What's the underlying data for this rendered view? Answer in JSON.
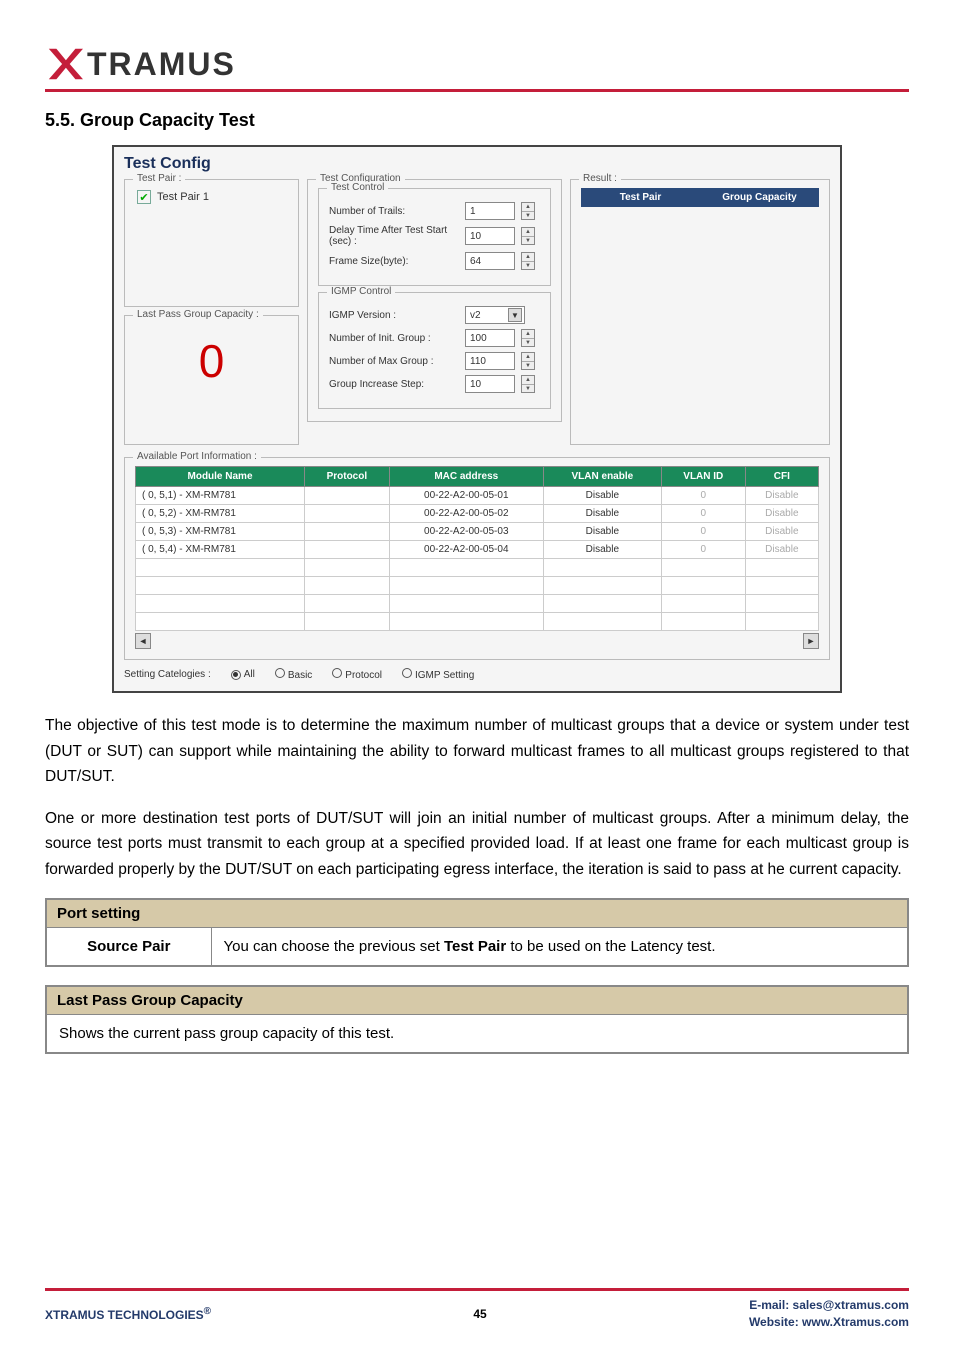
{
  "logo_text": "TRAMUS",
  "section_title": "5.5. Group Capacity Test",
  "ss": {
    "title": "Test Config",
    "test_pair_legend": "Test Pair :",
    "test_pair_item": "Test Pair 1",
    "last_pass_legend": "Last Pass Group Capacity :",
    "zero": "0",
    "test_config_legend": "Test Configuration",
    "test_control_legend": "Test Control",
    "trails_label": "Number of Trails:",
    "trails_val": "1",
    "delay_label": "Delay Time After Test Start (sec)  :",
    "delay_val": "10",
    "frame_label": "Frame Size(byte):",
    "frame_val": "64",
    "igmp_control_legend": "IGMP Control",
    "igmp_ver_label": "IGMP Version :",
    "igmp_ver_val": "v2",
    "init_group_label": "Number of Init. Group :",
    "init_group_val": "100",
    "max_group_label": "Number of Max Group :",
    "max_group_val": "110",
    "step_label": "Group Increase Step:",
    "step_val": "10",
    "result_legend": "Result :",
    "result_h1": "Test Pair",
    "result_h2": "Group Capacity",
    "avail_legend": "Available Port Information :",
    "cols": {
      "c1": "Module Name",
      "c2": "Protocol",
      "c3": "MAC address",
      "c4": "VLAN enable",
      "c5": "VLAN ID",
      "c6": "CFI"
    },
    "rows": [
      {
        "name": "( 0, 5,1) - XM-RM781",
        "proto": "",
        "mac": "00-22-A2-00-05-01",
        "vlan": "Disable",
        "id": "0",
        "cfi": "Disable"
      },
      {
        "name": "( 0, 5,2) - XM-RM781",
        "proto": "",
        "mac": "00-22-A2-00-05-02",
        "vlan": "Disable",
        "id": "0",
        "cfi": "Disable"
      },
      {
        "name": "( 0, 5,3) - XM-RM781",
        "proto": "",
        "mac": "00-22-A2-00-05-03",
        "vlan": "Disable",
        "id": "0",
        "cfi": "Disable"
      },
      {
        "name": "( 0, 5,4) - XM-RM781",
        "proto": "",
        "mac": "00-22-A2-00-05-04",
        "vlan": "Disable",
        "id": "0",
        "cfi": "Disable"
      }
    ],
    "cat_label": "Setting Catelogies :",
    "cat_all": "All",
    "cat_basic": "Basic",
    "cat_proto": "Protocol",
    "cat_igmp": "IGMP Setting"
  },
  "para1": "The objective of this test mode is to determine the maximum number of multicast groups that a device or system under test (DUT or SUT) can support while maintaining the ability to forward multicast frames to all multicast groups registered to that DUT/SUT.",
  "para2": "One or more destination test ports of DUT/SUT will join an initial number of multicast groups. After a minimum delay, the source test ports must transmit to each group at a specified provided load. If at least one frame for each multicast group is forwarded properly by the DUT/SUT on each participating egress interface, the iteration is said to pass at he current capacity.",
  "table1": {
    "header": "Port setting",
    "label": "Source Pair",
    "desc_pre": "You can choose the previous set ",
    "desc_bold": "Test Pair",
    "desc_post": " to be used on the Latency test."
  },
  "table2": {
    "header": "Last Pass Group Capacity",
    "desc": "Shows the current pass group capacity of this test."
  },
  "footer": {
    "left": "XTRAMUS TECHNOLOGIES",
    "reg": "®",
    "page": "45",
    "email": "E-mail: sales@xtramus.com",
    "web": "Website:  www.Xtramus.com"
  }
}
